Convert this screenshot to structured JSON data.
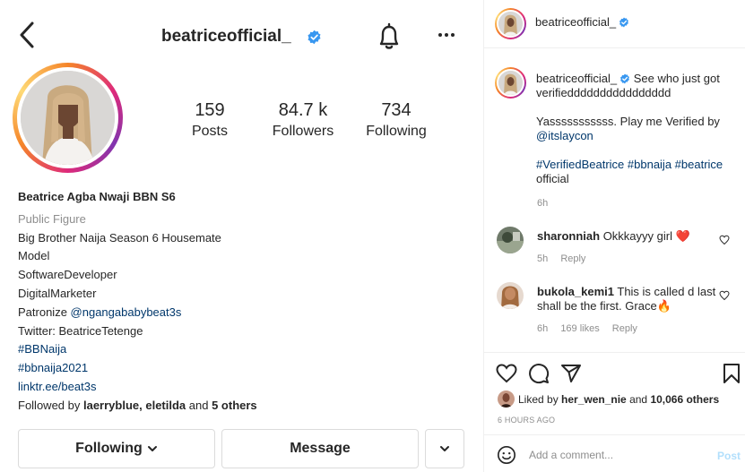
{
  "profile": {
    "username": "beatriceofficial_",
    "stats": [
      {
        "num": "159",
        "label": "Posts"
      },
      {
        "num": "84.7 k",
        "label": "Followers"
      },
      {
        "num": "734",
        "label": "Following"
      }
    ],
    "bio": {
      "full_name": "Beatrice Agba Nwaji BBN S6",
      "category": "Public Figure",
      "line1": "Big Brother Naija Season 6 Housemate",
      "line2": "Model",
      "line3": "SoftwareDeveloper",
      "line4": "DigitalMarketer",
      "patronize_prefix": "Patronize ",
      "patronize_handle": "@ngangababybeat3s",
      "twitter": "Twitter: BeatriceTetenge",
      "tag1": "#BBNaija",
      "tag2": "#bbnaija2021",
      "website": "linktr.ee/beat3s",
      "followed_prefix": "Followed by ",
      "followed_names": "laerryblue, eletilda",
      "followed_and": " and ",
      "followed_others": "5 others"
    },
    "buttons": {
      "following": "Following",
      "message": "Message"
    }
  },
  "post": {
    "header_username": "beatriceofficial_",
    "caption": {
      "username": "beatriceofficial_",
      "text1": " See who just got verifiedddddddddddddddd",
      "text2": "Yasssssssssss. Play me Verified by",
      "mention": "@itslaycon",
      "tags": "#VerifiedBeatrice #bbnaija #beatrice",
      "tail": "official",
      "time": "6h"
    },
    "comments": [
      {
        "user": "sharonniah",
        "text": " Okkkayyy girl ❤️",
        "time": "5h",
        "likes": "",
        "reply": "Reply"
      },
      {
        "user": "bukola_kemi1",
        "text": " This is called d last shall be the first. Grace🔥",
        "time": "6h",
        "likes": "169 likes",
        "reply": "Reply"
      }
    ],
    "liked_prefix": "Liked by ",
    "liked_user": "her_wen_nie",
    "liked_and": " and ",
    "liked_count": "10,066 others",
    "posted_ago": "6 HOURS AGO",
    "comment_placeholder": "Add a comment...",
    "post_label": "Post"
  },
  "colors": {
    "link": "#00376b",
    "verified": "#3897f0",
    "muted": "#8e8e8e",
    "post_disabled": "#b2dffc"
  }
}
